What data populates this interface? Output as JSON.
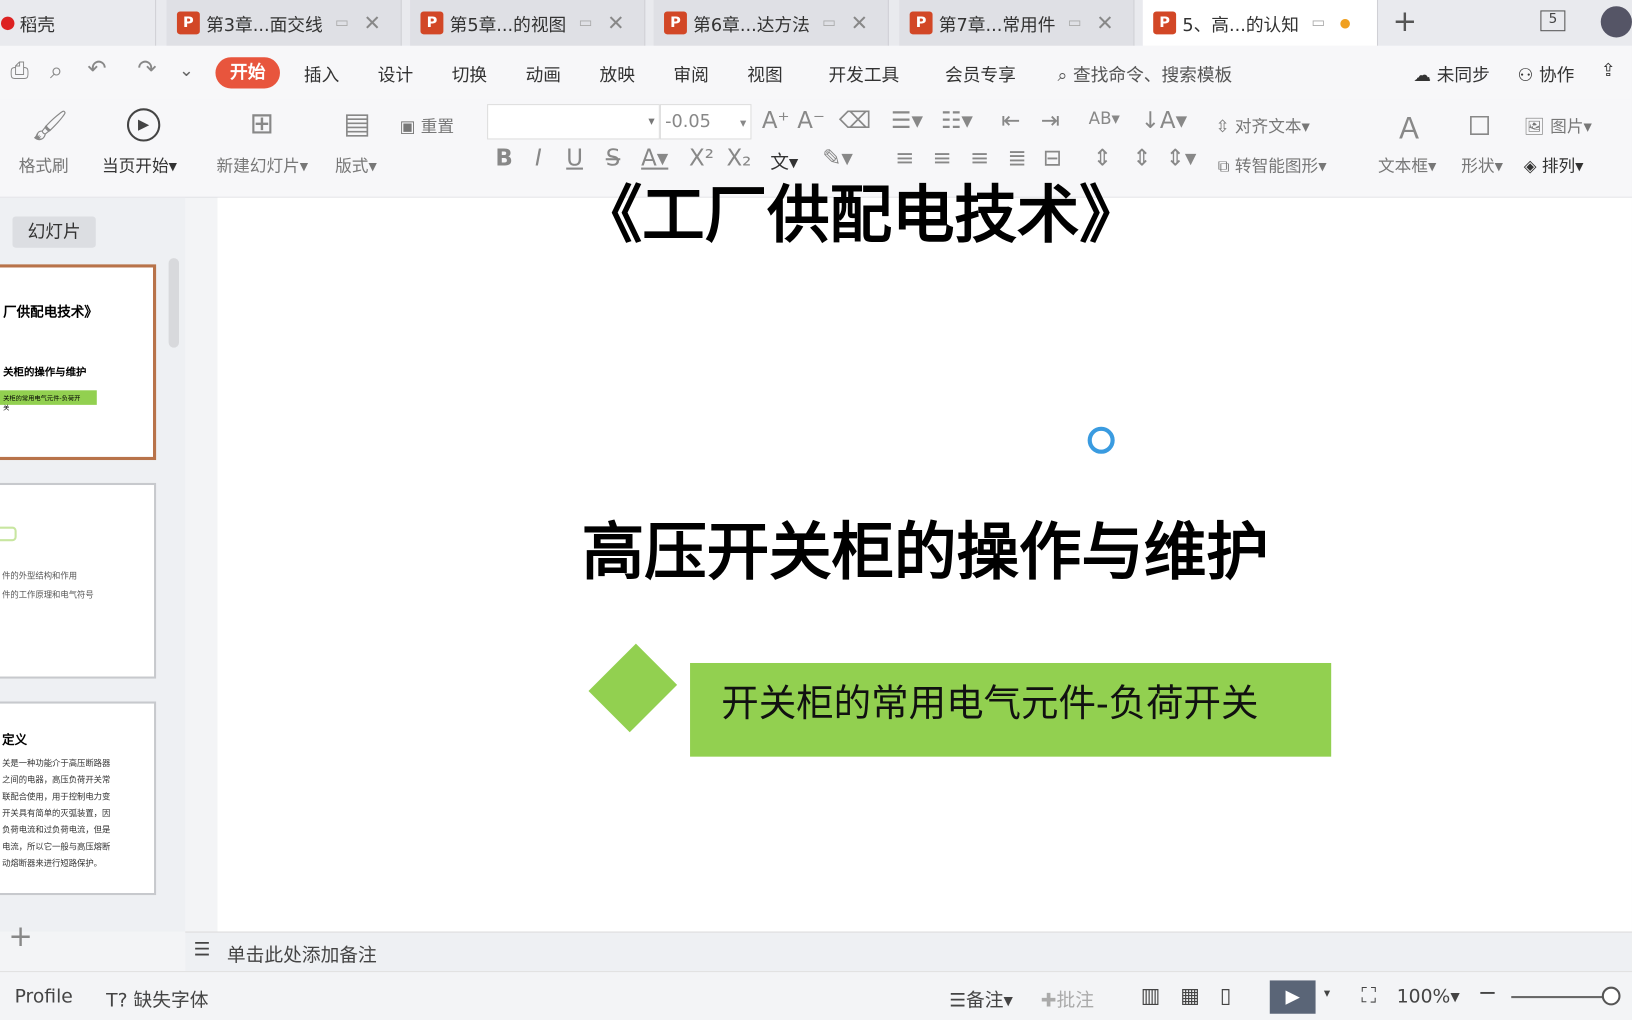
{
  "tabs": [
    {
      "label": "稻壳",
      "active": false
    },
    {
      "label": "第3章...面交线",
      "active": false
    },
    {
      "label": "第5章...的视图",
      "active": false
    },
    {
      "label": "第6章...达方法",
      "active": false
    },
    {
      "label": "第7章...常用件",
      "active": false
    },
    {
      "label": "5、高...的认知",
      "active": true
    }
  ],
  "window": {
    "tab_count": "5"
  },
  "menu": {
    "items": [
      "开始",
      "插入",
      "设计",
      "切换",
      "动画",
      "放映",
      "审阅",
      "视图",
      "开发工具",
      "会员专享"
    ],
    "search": "查找命令、搜索模板",
    "sync": "未同步",
    "collab": "协作"
  },
  "ribbon": {
    "format_painter": "格式刷",
    "play_from_current": "当页开始",
    "new_slide": "新建幻灯片",
    "layout": "版式",
    "reset": "重置",
    "font_name": "",
    "font_size": "-0.05",
    "align_text": "对齐文本",
    "smart_shape": "转智能图形",
    "textbox": "文本框",
    "shape": "形状",
    "picture": "图片",
    "arrange": "排列"
  },
  "sidebar": {
    "tab": "幻灯片",
    "thumbs": [
      {
        "title": "厂供配电技术》",
        "sub": "关柜的操作与维护",
        "tag": "关柜的常用电气元件-负荷开关"
      },
      {
        "lines": [
          "件的外型结构和作用",
          "件的工作原理和电气符号"
        ]
      },
      {
        "title": "定义",
        "lines": [
          "关是一种功能介于高压断路器",
          "之间的电器，高压负荷开关常",
          "联配合使用，用于控制电力变",
          "开关具有简单的灭弧装置，因",
          "负荷电流和过负荷电流，但是",
          "电流，所以它一般与高压熔断",
          "动熔断器来进行短路保护。"
        ]
      }
    ]
  },
  "slide": {
    "title": "《工厂供配电技术》",
    "subtitle": "高压开关柜的操作与维护",
    "tag": "开关柜的常用电气元件-负荷开关",
    "accent": "#92d050"
  },
  "notes": {
    "placeholder": "单击此处添加备注"
  },
  "status": {
    "profile": "Profile",
    "missing_font": "缺失字体",
    "notes": "备注",
    "comment": "批注",
    "zoom": "100%",
    "zoom_level": 100
  }
}
